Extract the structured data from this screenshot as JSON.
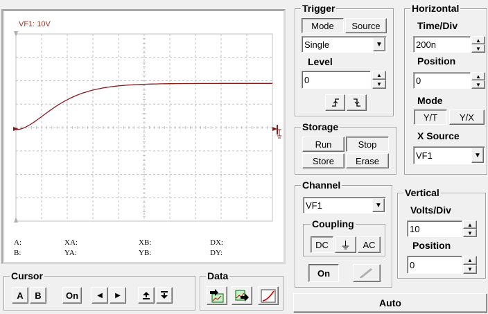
{
  "scope": {
    "channel_label": "VF1: 10V",
    "cursor_readouts": {
      "a": "A:",
      "b": "B:",
      "xa": "XA:",
      "ya": "YA:",
      "xb": "XB:",
      "yb": "YB:",
      "dx": "DX:",
      "dy": "DY:"
    },
    "trace_color": "#8b1a1a",
    "grid_color": "#c0c0c0",
    "trace_level_volts": 2.3,
    "trigger_level_volts": 0
  },
  "cursor": {
    "title": "Cursor",
    "a_label": "A",
    "b_label": "B",
    "on_label": "On",
    "left_icon": "triangle-left-icon",
    "right_icon": "triangle-right-icon",
    "up_icon": "arrow-up-bar-icon",
    "down_icon": "arrow-down-bar-icon"
  },
  "data": {
    "title": "Data",
    "icons": [
      "export-chart-icon",
      "save-data-icon",
      "plot-curve-icon"
    ]
  },
  "trigger": {
    "title": "Trigger",
    "mode_tab": "Mode",
    "source_tab": "Source",
    "mode_value": "Single",
    "level_label": "Level",
    "level_value": "0",
    "rising_icon": "rising-edge-icon",
    "falling_icon": "falling-edge-icon"
  },
  "horizontal": {
    "title": "Horizontal",
    "time_div_label": "Time/Div",
    "time_div_value": "200n",
    "position_label": "Position",
    "position_value": "0",
    "mode_label": "Mode",
    "yt_label": "Y/T",
    "yx_label": "Y/X",
    "xsource_label": "X Source",
    "xsource_value": "VF1"
  },
  "storage": {
    "title": "Storage",
    "run_label": "Run",
    "stop_label": "Stop",
    "store_label": "Store",
    "erase_label": "Erase"
  },
  "channel": {
    "title": "Channel",
    "value": "VF1",
    "coupling_label": "Coupling",
    "dc_label": "DC",
    "gnd_label": "⏚",
    "ac_label": "AC",
    "on_label": "On",
    "probe_icon": "probe-icon"
  },
  "vertical": {
    "title": "Vertical",
    "volts_div_label": "Volts/Div",
    "volts_div_value": "10",
    "position_label": "Position",
    "position_value": "0"
  },
  "auto_label": "Auto"
}
